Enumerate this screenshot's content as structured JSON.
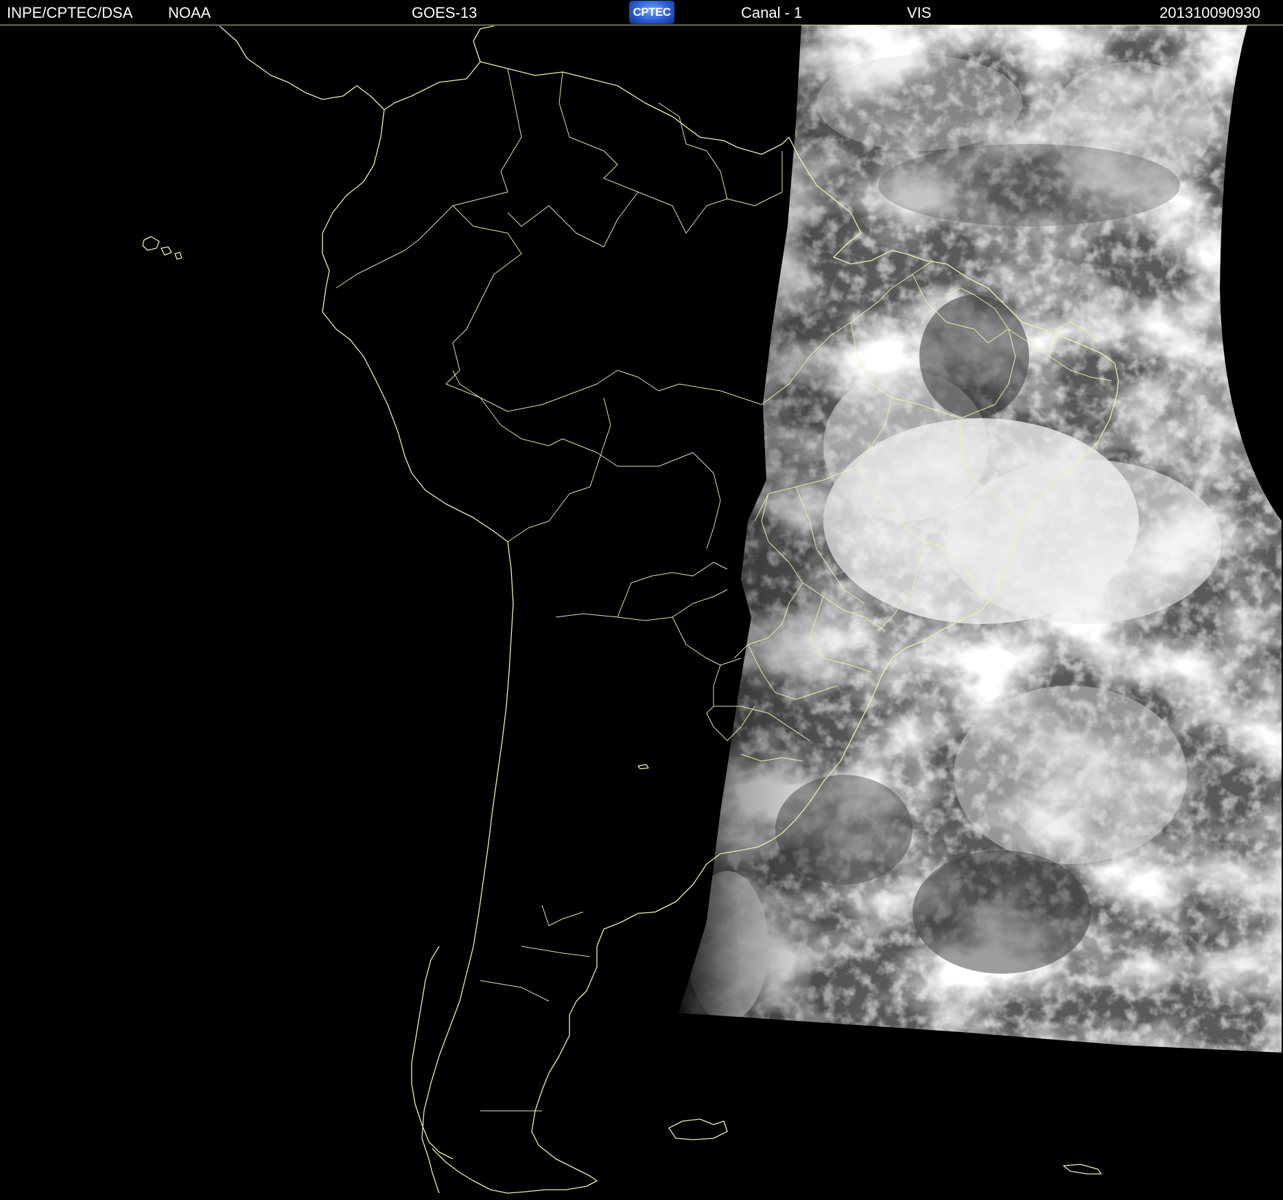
{
  "header": {
    "institution": "INPE/CPTEC/DSA",
    "agency": "NOAA",
    "satellite": "GOES-13",
    "logo_text": "CPTEC",
    "channel": "Canal - 1",
    "band": "VIS",
    "timestamp": "201310090930"
  },
  "map": {
    "background_color": "#000000",
    "coastline_color": "#f2f2b0",
    "imagery_colors": [
      "#2e2e2e",
      "#5a5a5a",
      "#8c8c8c",
      "#d8d8d8",
      "#ffffff"
    ]
  }
}
